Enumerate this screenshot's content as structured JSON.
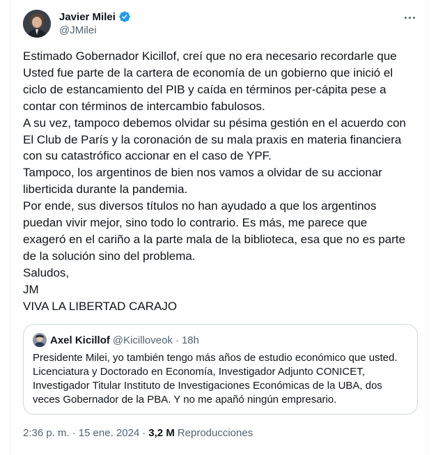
{
  "author": {
    "name": "Javier Milei",
    "handle": "@JMilei",
    "verified_color": "#1d9bf0"
  },
  "tweet": {
    "lines": [
      "Estimado Gobernador Kicillof, creí que no era necesario recordarle que",
      "Usted fue parte de la cartera de economía de un gobierno que inició el",
      "ciclo de estancamiento del PIB y caída en términos per-cápita pese a",
      "contar con términos de intercambio fabulosos.",
      "A su vez, tampoco debemos olvidar su pésima gestión en el acuerdo con",
      "El Club de París y la coronación de su mala praxis en materia financiera",
      "con su catastrófico accionar en el caso de YPF.",
      "Tampoco, los argentinos de bien nos vamos a olvidar de su accionar",
      "liberticida durante la pandemia.",
      "Por ende, sus diversos títulos no han ayudado a que los argentinos",
      "puedan vivir mejor, sino todo lo contrario. Es más, me parece que",
      "exageró en el cariño a la parte mala de la biblioteca, esa que no es parte",
      "de la solución sino del problema.",
      "Saludos,",
      "JM",
      "VIVA LA LIBERTAD CARAJO"
    ]
  },
  "quote": {
    "name": "Axel Kicillof",
    "handle": "@Kicilloveok",
    "dot": "·",
    "time": "18h",
    "lines": [
      "Presidente Milei, yo también tengo más años de estudio económico que usted.",
      "Licenciatura y Doctorado en Economía, Investigador Adjunto CONICET,",
      "Investigador Titular Instituto de Investigaciones Económicas de la UBA, dos",
      "veces Gobernador de la PBA. Y no me apañó ningún empresario."
    ]
  },
  "meta": {
    "time": "2:36 p. m.",
    "sep1": "·",
    "date": "15 ene. 2024",
    "sep2": "·",
    "views_count": "3,2 M",
    "views_label": "Reproducciones"
  },
  "icons": {
    "more": "more-horizontal-icon",
    "verified": "verified-badge-icon"
  }
}
